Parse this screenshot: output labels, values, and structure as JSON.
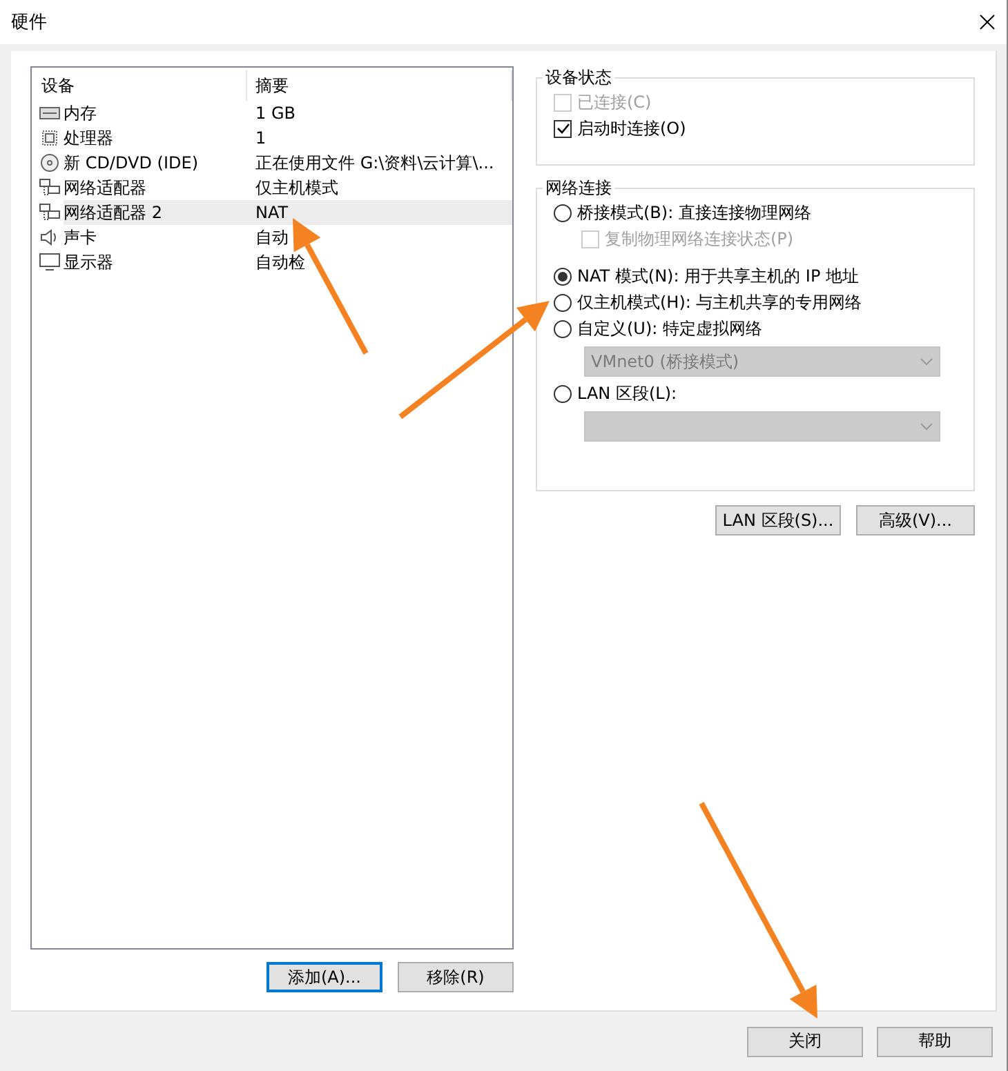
{
  "window": {
    "title": "硬件"
  },
  "device_list": {
    "columns": [
      "设备",
      "摘要"
    ],
    "rows": [
      {
        "kind": "memory",
        "name": "内存",
        "summary": "1 GB",
        "selected": false
      },
      {
        "kind": "cpu",
        "name": "处理器",
        "summary": "1",
        "selected": false
      },
      {
        "kind": "disc",
        "name": "新 CD/DVD (IDE)",
        "summary": "正在使用文件 G:\\资料\\云计算\\...",
        "selected": false
      },
      {
        "kind": "network",
        "name": "网络适配器",
        "summary": "仅主机模式",
        "selected": false
      },
      {
        "kind": "network",
        "name": "网络适配器 2",
        "summary": "NAT",
        "selected": true
      },
      {
        "kind": "sound",
        "name": "声卡",
        "summary": "自动",
        "selected": false
      },
      {
        "kind": "display",
        "name": "显示器",
        "summary": "自动检",
        "selected": false
      }
    ]
  },
  "list_buttons": [
    {
      "label": "添加(A)...",
      "focused": true
    },
    {
      "label": "移除(R)",
      "focused": false
    }
  ],
  "device_status": {
    "title": "设备状态",
    "options": [
      {
        "label": "已连接(C)",
        "checked": false,
        "disabled": true
      },
      {
        "label": "启动时连接(O)",
        "checked": true,
        "disabled": false
      }
    ]
  },
  "network_connection": {
    "title": "网络连接",
    "options": [
      {
        "kind": "radio",
        "label": "桥接模式(B): 直接连接物理网络",
        "selected": false
      },
      {
        "kind": "checkbox",
        "label": "复制物理网络连接状态(P)",
        "checked": false,
        "disabled": true
      },
      {
        "kind": "radio",
        "label": "NAT 模式(N): 用于共享主机的 IP 地址",
        "selected": true
      },
      {
        "kind": "radio",
        "label": "仅主机模式(H): 与主机共享的专用网络",
        "selected": false
      },
      {
        "kind": "radio",
        "label": "自定义(U): 特定虚拟网络",
        "selected": false
      },
      {
        "kind": "select",
        "value": "VMnet0 (桥接模式)",
        "disabled": true
      },
      {
        "kind": "radio",
        "label": "LAN 区段(L):",
        "selected": false
      },
      {
        "kind": "select",
        "disabled": true
      }
    ]
  },
  "network_buttons": [
    "LAN 区段(S)...",
    "高级(V)..."
  ],
  "footer_buttons": [
    "关闭",
    "帮助"
  ]
}
